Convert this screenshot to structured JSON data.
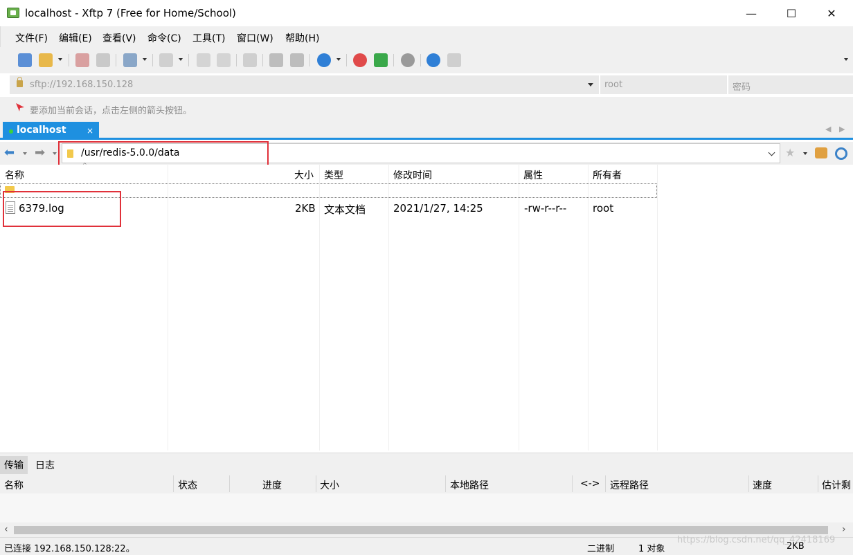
{
  "window": {
    "title": "localhost - Xftp 7 (Free for Home/School)",
    "minimize": "—",
    "maximize": "☐",
    "close": "✕"
  },
  "menu": [
    "文件(F)",
    "编辑(E)",
    "查看(V)",
    "命令(C)",
    "工具(T)",
    "窗口(W)",
    "帮助(H)"
  ],
  "address": {
    "host_placeholder": "sftp://192.168.150.128",
    "user_placeholder": "root",
    "password_placeholder": "密码"
  },
  "hint": "要添加当前会话，点击左侧的箭头按钮。",
  "tabs": [
    {
      "label": "localhost",
      "close": "×"
    }
  ],
  "path": "/usr/redis-5.0.0/data",
  "columns": [
    "名称",
    "大小",
    "类型",
    "修改时间",
    "属性",
    "所有者"
  ],
  "parent_row": "..",
  "files": [
    {
      "name": "6379.log",
      "size": "2KB",
      "type": "文本文档",
      "modified": "2021/1/27, 14:25",
      "attributes": "-rw-r--r--",
      "owner": "root"
    }
  ],
  "bottom_tabs": [
    "传输",
    "日志"
  ],
  "transfer_columns": [
    "名称",
    "状态",
    "进度",
    "大小",
    "本地路径",
    "<->",
    "远程路径",
    "速度",
    "估计剩"
  ],
  "status": {
    "connection": "已连接 192.168.150.128:22。",
    "mode": "二进制",
    "objects": "1 对象",
    "size": "2KB"
  },
  "watermark": "https://blog.csdn.net/qq_42418169",
  "colors": {
    "accent": "#1e90e0",
    "highlight_box": "#e0313a"
  }
}
